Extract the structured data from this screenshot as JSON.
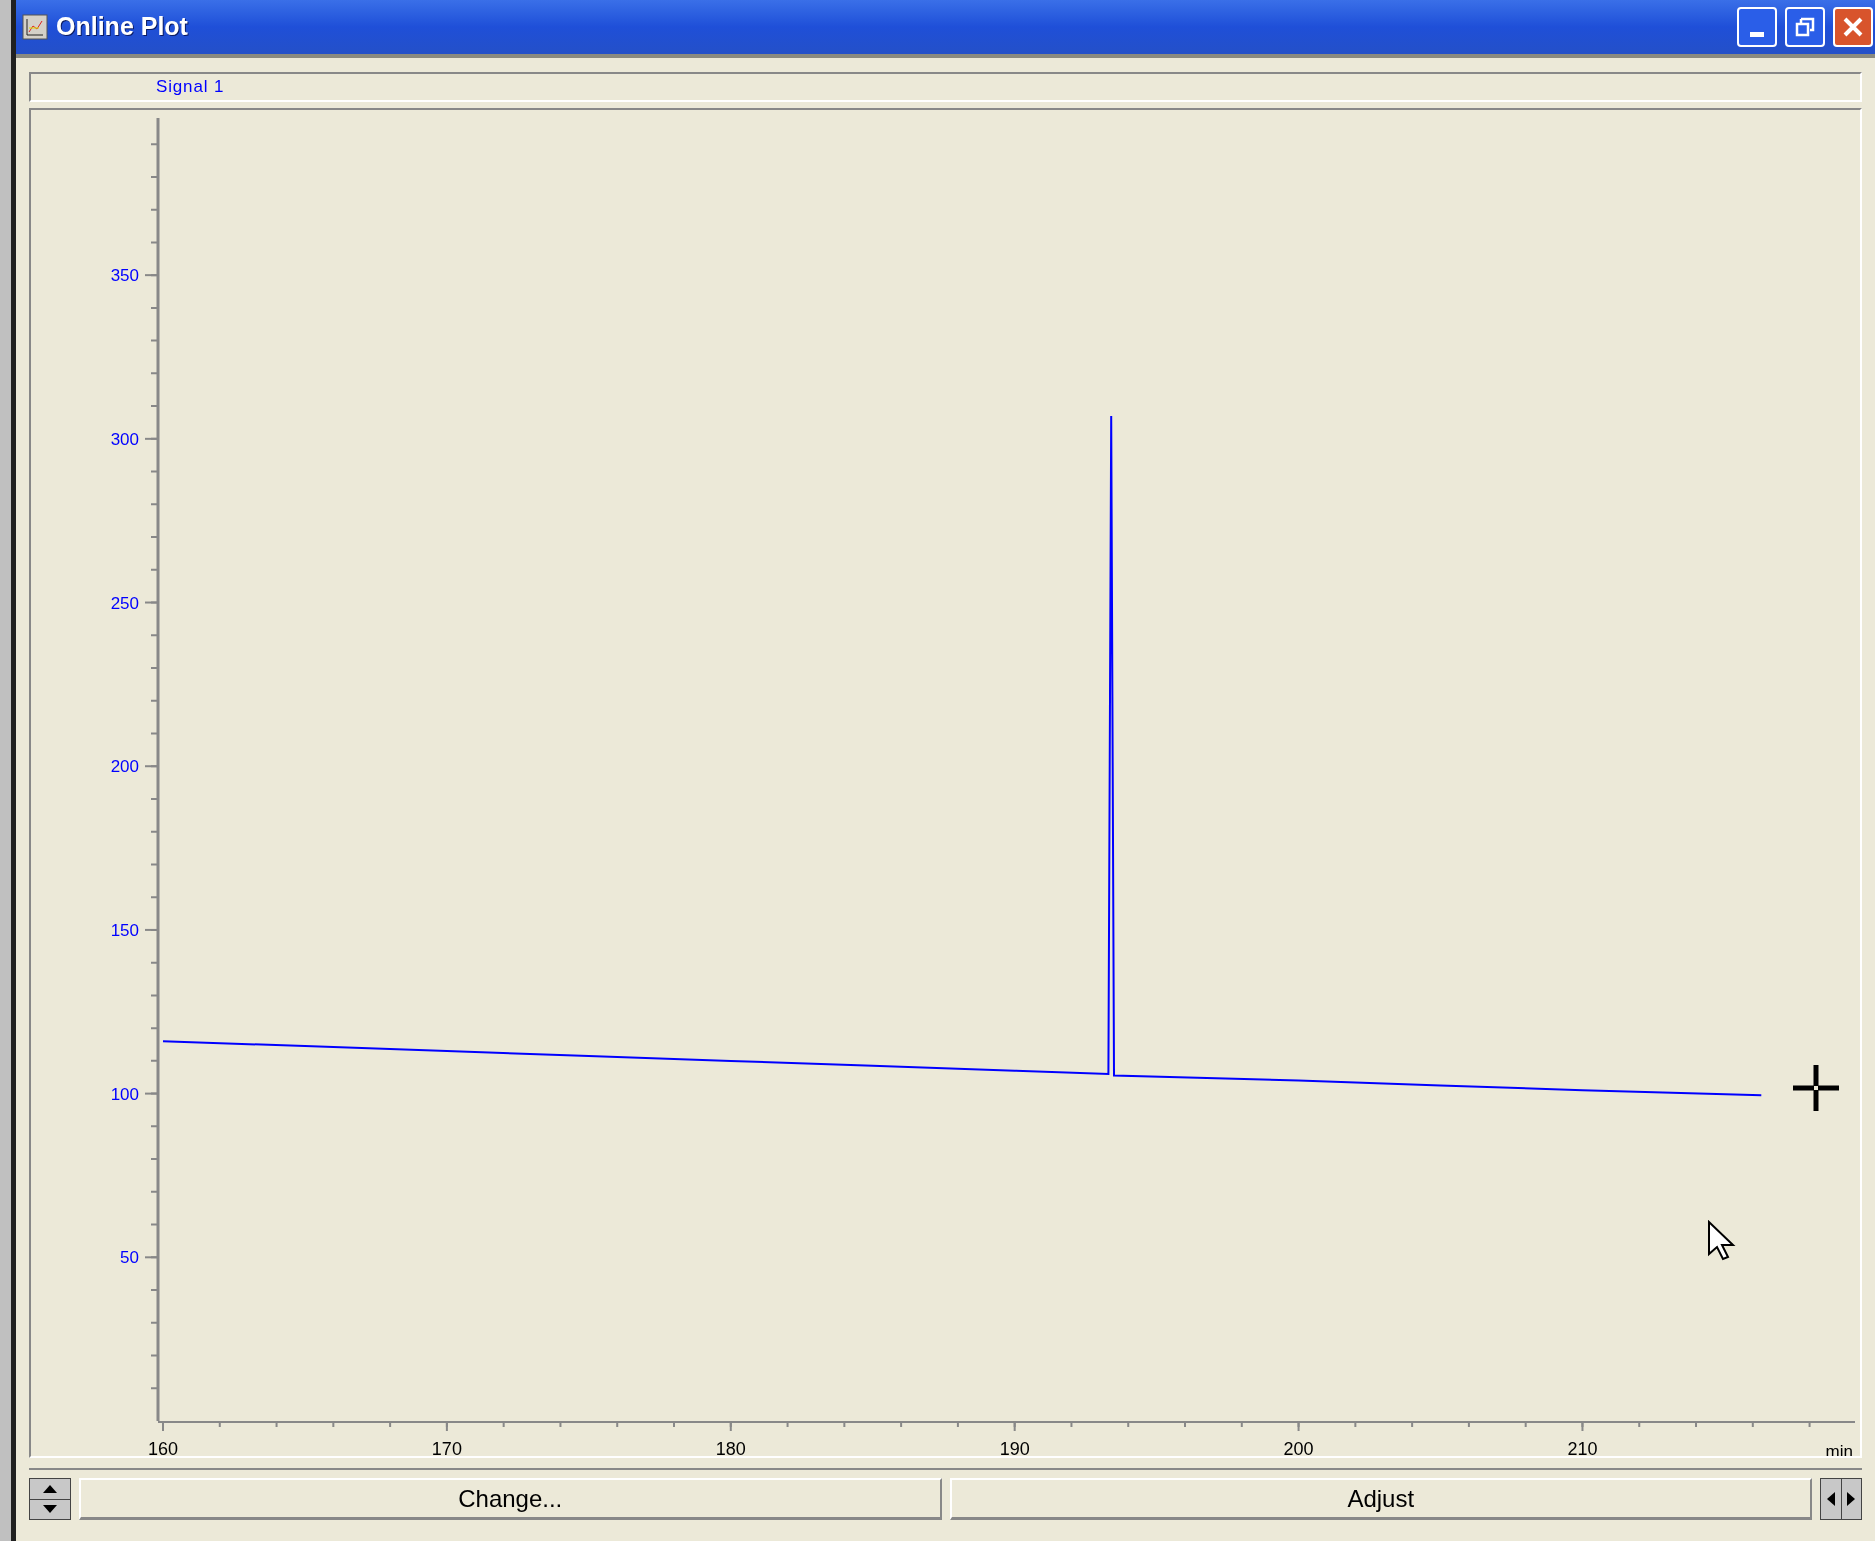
{
  "window": {
    "title": "Online Plot"
  },
  "plot": {
    "chart_data": {
      "type": "line",
      "xlabel": "min",
      "xlim": [
        160,
        219.6
      ],
      "ylim": [
        0,
        398
      ],
      "xticks": [
        160,
        170,
        180,
        190,
        200,
        210
      ],
      "yticks": [
        50,
        100,
        150,
        200,
        250,
        300,
        350
      ],
      "x": [
        160,
        165,
        170,
        175,
        180,
        185,
        190,
        193.3,
        193.4,
        193.5,
        200,
        205,
        210,
        216.3
      ],
      "series": [
        {
          "name": "Signal 1",
          "color": "#0000ff",
          "values": [
            116,
            114.5,
            113,
            111.5,
            110,
            108.5,
            107,
            106,
            307,
            105.5,
            104,
            102.5,
            101,
            99.5
          ]
        }
      ]
    }
  },
  "buttons": [
    {
      "label": "Change..."
    },
    {
      "label": "Adjust"
    }
  ]
}
